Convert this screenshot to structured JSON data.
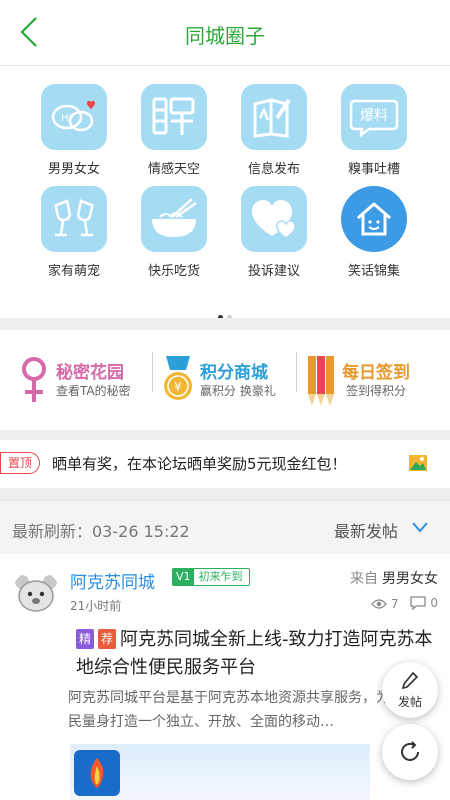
{
  "header": {
    "title": "同城圈子",
    "back_icon": "chevron-left-icon"
  },
  "categories": [
    {
      "label": "男男女女",
      "icon": "chat-bubbles-heart-icon"
    },
    {
      "label": "情感天空",
      "icon": "pin-character-icon"
    },
    {
      "label": "信息发布",
      "icon": "book-pen-icon"
    },
    {
      "label": "糗事吐槽",
      "icon": "bubble-text-icon",
      "icon_text": "爆料"
    },
    {
      "label": "家有萌宠",
      "icon": "wine-glasses-icon"
    },
    {
      "label": "快乐吃货",
      "icon": "noodle-bowl-icon"
    },
    {
      "label": "投诉建议",
      "icon": "hearts-icon"
    },
    {
      "label": "笑话锦集",
      "icon": "smiley-house-icon"
    }
  ],
  "pager": {
    "pages": 2,
    "active": 1
  },
  "features": [
    {
      "title": "秘密花园",
      "subtitle": "查看TA的秘密",
      "color": "#d66aa8",
      "icon": "female-symbol-icon"
    },
    {
      "title": "积分商城",
      "subtitle": "赢积分 换豪礼",
      "color": "#2a9fd8",
      "icon": "medal-icon"
    },
    {
      "title": "每日签到",
      "subtitle": "签到得积分",
      "color": "#e8982c",
      "icon": "pencils-icon"
    }
  ],
  "notice": {
    "badge": "置顶",
    "text": "晒单有奖，在本论坛晒单奖励5元现金红包！",
    "icon": "image-icon"
  },
  "feed_header": {
    "refresh_text": "最新刷新：03-26 15:22",
    "sort_label": "最新发帖",
    "sort_icon": "chevron-down-icon"
  },
  "post": {
    "author": "阿克苏同城",
    "level": "V1",
    "level_title": "初来乍到",
    "from_prefix": "来自",
    "from_category": "男男女女",
    "time": "21小时前",
    "views": "7",
    "comments": "0",
    "tags": [
      "精",
      "荐"
    ],
    "title": "阿克苏同城全新上线-致力打造阿克苏本地综合性便民服务平台",
    "body": "阿克苏同城平台是基于阿克苏本地资源共享服务，为本地居民量身打造一个独立、开放、全面的移动…"
  },
  "fab": {
    "post_label": "发帖",
    "post_icon": "pen-icon",
    "refresh_icon": "refresh-icon"
  },
  "colors": {
    "accent": "#2aa83a",
    "tile": "#a6dcf3",
    "link": "#2b8de0"
  }
}
